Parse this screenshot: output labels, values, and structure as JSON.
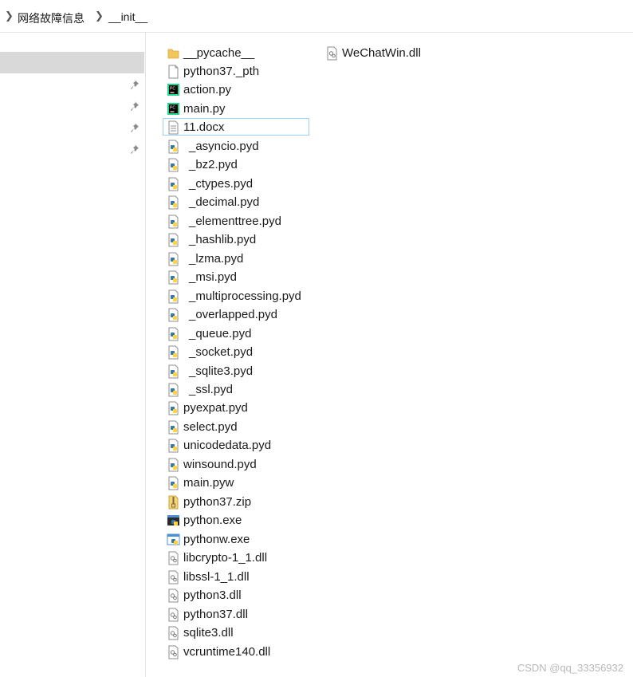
{
  "breadcrumb": {
    "parent": "网络故障信息",
    "current": "__init__"
  },
  "files": [
    {
      "name": "__pycache__",
      "icon": "folder-icon"
    },
    {
      "name": "WeChatWin.dll",
      "icon": "dll-icon"
    },
    {
      "name": "python37._pth",
      "icon": "blank-file-icon"
    },
    {
      "name": "action.py",
      "icon": "pycharm-icon"
    },
    {
      "name": "main.py",
      "icon": "pycharm-icon"
    },
    {
      "name": "11.docx",
      "icon": "document-icon"
    },
    {
      "name": "_asyncio.pyd",
      "icon": "python-file-icon"
    },
    {
      "name": "_bz2.pyd",
      "icon": "python-file-icon"
    },
    {
      "name": "_ctypes.pyd",
      "icon": "python-file-icon"
    },
    {
      "name": "_decimal.pyd",
      "icon": "python-file-icon"
    },
    {
      "name": "_elementtree.pyd",
      "icon": "python-file-icon"
    },
    {
      "name": "_hashlib.pyd",
      "icon": "python-file-icon"
    },
    {
      "name": "_lzma.pyd",
      "icon": "python-file-icon"
    },
    {
      "name": "_msi.pyd",
      "icon": "python-file-icon"
    },
    {
      "name": "_multiprocessing.pyd",
      "icon": "python-file-icon"
    },
    {
      "name": "_overlapped.pyd",
      "icon": "python-file-icon"
    },
    {
      "name": "_queue.pyd",
      "icon": "python-file-icon"
    },
    {
      "name": "_socket.pyd",
      "icon": "python-file-icon"
    },
    {
      "name": "_sqlite3.pyd",
      "icon": "python-file-icon"
    },
    {
      "name": "_ssl.pyd",
      "icon": "python-file-icon"
    },
    {
      "name": "pyexpat.pyd",
      "icon": "python-file-icon"
    },
    {
      "name": "select.pyd",
      "icon": "python-file-icon"
    },
    {
      "name": "unicodedata.pyd",
      "icon": "python-file-icon"
    },
    {
      "name": "winsound.pyd",
      "icon": "python-file-icon"
    },
    {
      "name": "main.pyw",
      "icon": "python-file-icon"
    },
    {
      "name": "python37.zip",
      "icon": "zip-icon"
    },
    {
      "name": "python.exe",
      "icon": "python-exe-icon"
    },
    {
      "name": "pythonw.exe",
      "icon": "python-exe-icon"
    },
    {
      "name": "libcrypto-1_1.dll",
      "icon": "dll-icon"
    },
    {
      "name": "libssl-1_1.dll",
      "icon": "dll-icon"
    },
    {
      "name": "python3.dll",
      "icon": "dll-icon"
    },
    {
      "name": "python37.dll",
      "icon": "dll-icon"
    },
    {
      "name": "sqlite3.dll",
      "icon": "dll-icon"
    },
    {
      "name": "vcruntime140.dll",
      "icon": "dll-icon"
    }
  ],
  "watermark": "CSDN @qq_33356932",
  "colors": {
    "selection_border": "#99d1ff",
    "nav_selected": "#d9d9d9"
  }
}
